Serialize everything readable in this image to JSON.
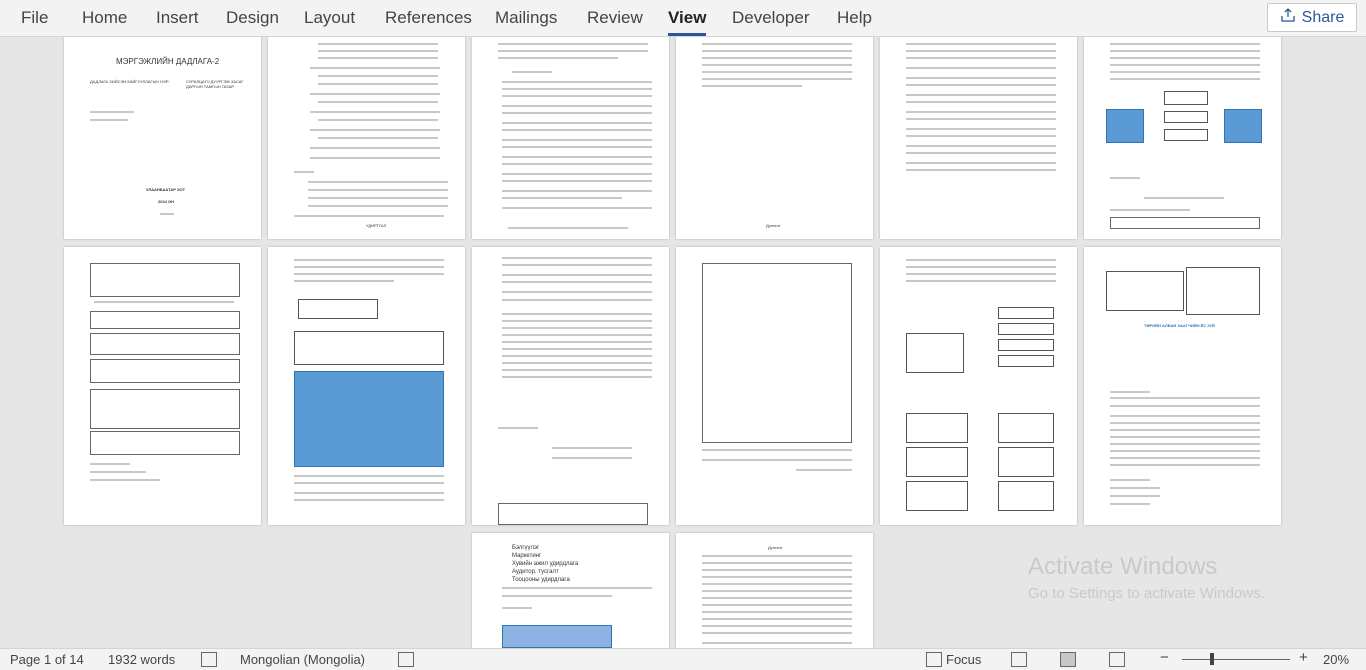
{
  "ribbon": {
    "tabs": [
      "File",
      "Home",
      "Insert",
      "Design",
      "Layout",
      "References",
      "Mailings",
      "Review",
      "View",
      "Developer",
      "Help"
    ],
    "active_tab": "View",
    "share_label": "Share"
  },
  "document": {
    "page1_title": "МЭРГЭЖЛИЙН ДАДЛАГА-2",
    "page1_org_left": "ДАДЛАГА ХИЙСЭН БАЙГУУЛЛАГЫН НЭР:",
    "page1_org_right": "СУРАЛЦАГЧ ДУУРГЭЖ ЗАСАГ ДАРГЫН ТАМГЫН ГАЗАР",
    "page1_city": "УЛААНБААТАР ХОТ",
    "page1_year": "2024 ОН",
    "page2_heading": "УДИРТГАЛ",
    "page4_heading": "Дүгнэлт",
    "page10_title": "ТӨРИЙН АЛБАН ХААГЧИЙН ЁС ЗҮЙ",
    "page12_list": [
      "Бэлгүүлэг",
      "Маркетинг",
      "Хувийн ажил удирдлага",
      "Аудитор, тусгалт",
      "Тооцооны удирдлага"
    ],
    "page13_heading": "Дүгнэлт"
  },
  "watermark": {
    "line1": "Activate Windows",
    "line2": "Go to Settings to activate Windows."
  },
  "status": {
    "page": "Page 1 of 14",
    "words": "1932 words",
    "language": "Mongolian (Mongolia)",
    "focus": "Focus",
    "zoom": "20%"
  }
}
